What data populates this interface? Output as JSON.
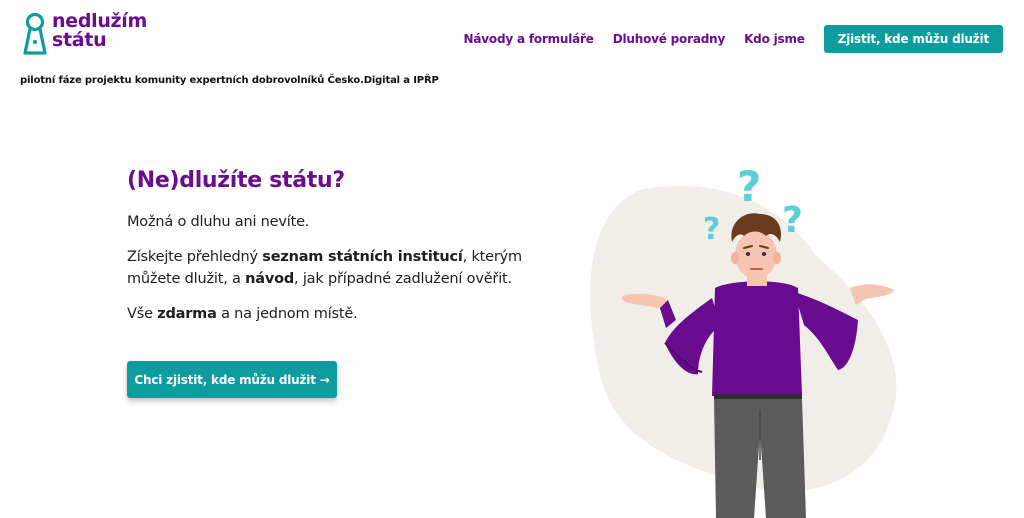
{
  "header": {
    "logo": {
      "line1": "nedlužím",
      "line2": "státu",
      "icon": "keyhole-person-icon"
    },
    "tagline": "pilotní fáze projektu komunity expertních dobrovolníků Česko.Digital a IPŘP",
    "nav": [
      {
        "label": "Návody a formuláře"
      },
      {
        "label": "Dluhové poradny"
      },
      {
        "label": "Kdo jsme"
      }
    ],
    "cta_label": "Zjistit, kde můžu dlužit"
  },
  "hero": {
    "title": "(Ne)dlužíte státu?",
    "p1": "Možná o dluhu ani nevíte.",
    "p2_pre": "Získejte přehledný ",
    "p2_bold1": "seznam státních institucí",
    "p2_mid": ", kterým můžete dlužit, a ",
    "p2_bold2": "návod",
    "p2_post": ", jak případné zadlužení ověřit.",
    "p3_pre": "Vše ",
    "p3_bold": "zdarma",
    "p3_post": " a na jednom místě.",
    "button_label": "Chci zjistit, kde můžu dlužit →"
  },
  "colors": {
    "brand_purple": "#6a0d8e",
    "brand_teal": "#0e9c9e",
    "question_mark": "#5ccfd6",
    "blob": "#f1ede9"
  },
  "illustration": {
    "icon": "confused-person-illustration"
  }
}
